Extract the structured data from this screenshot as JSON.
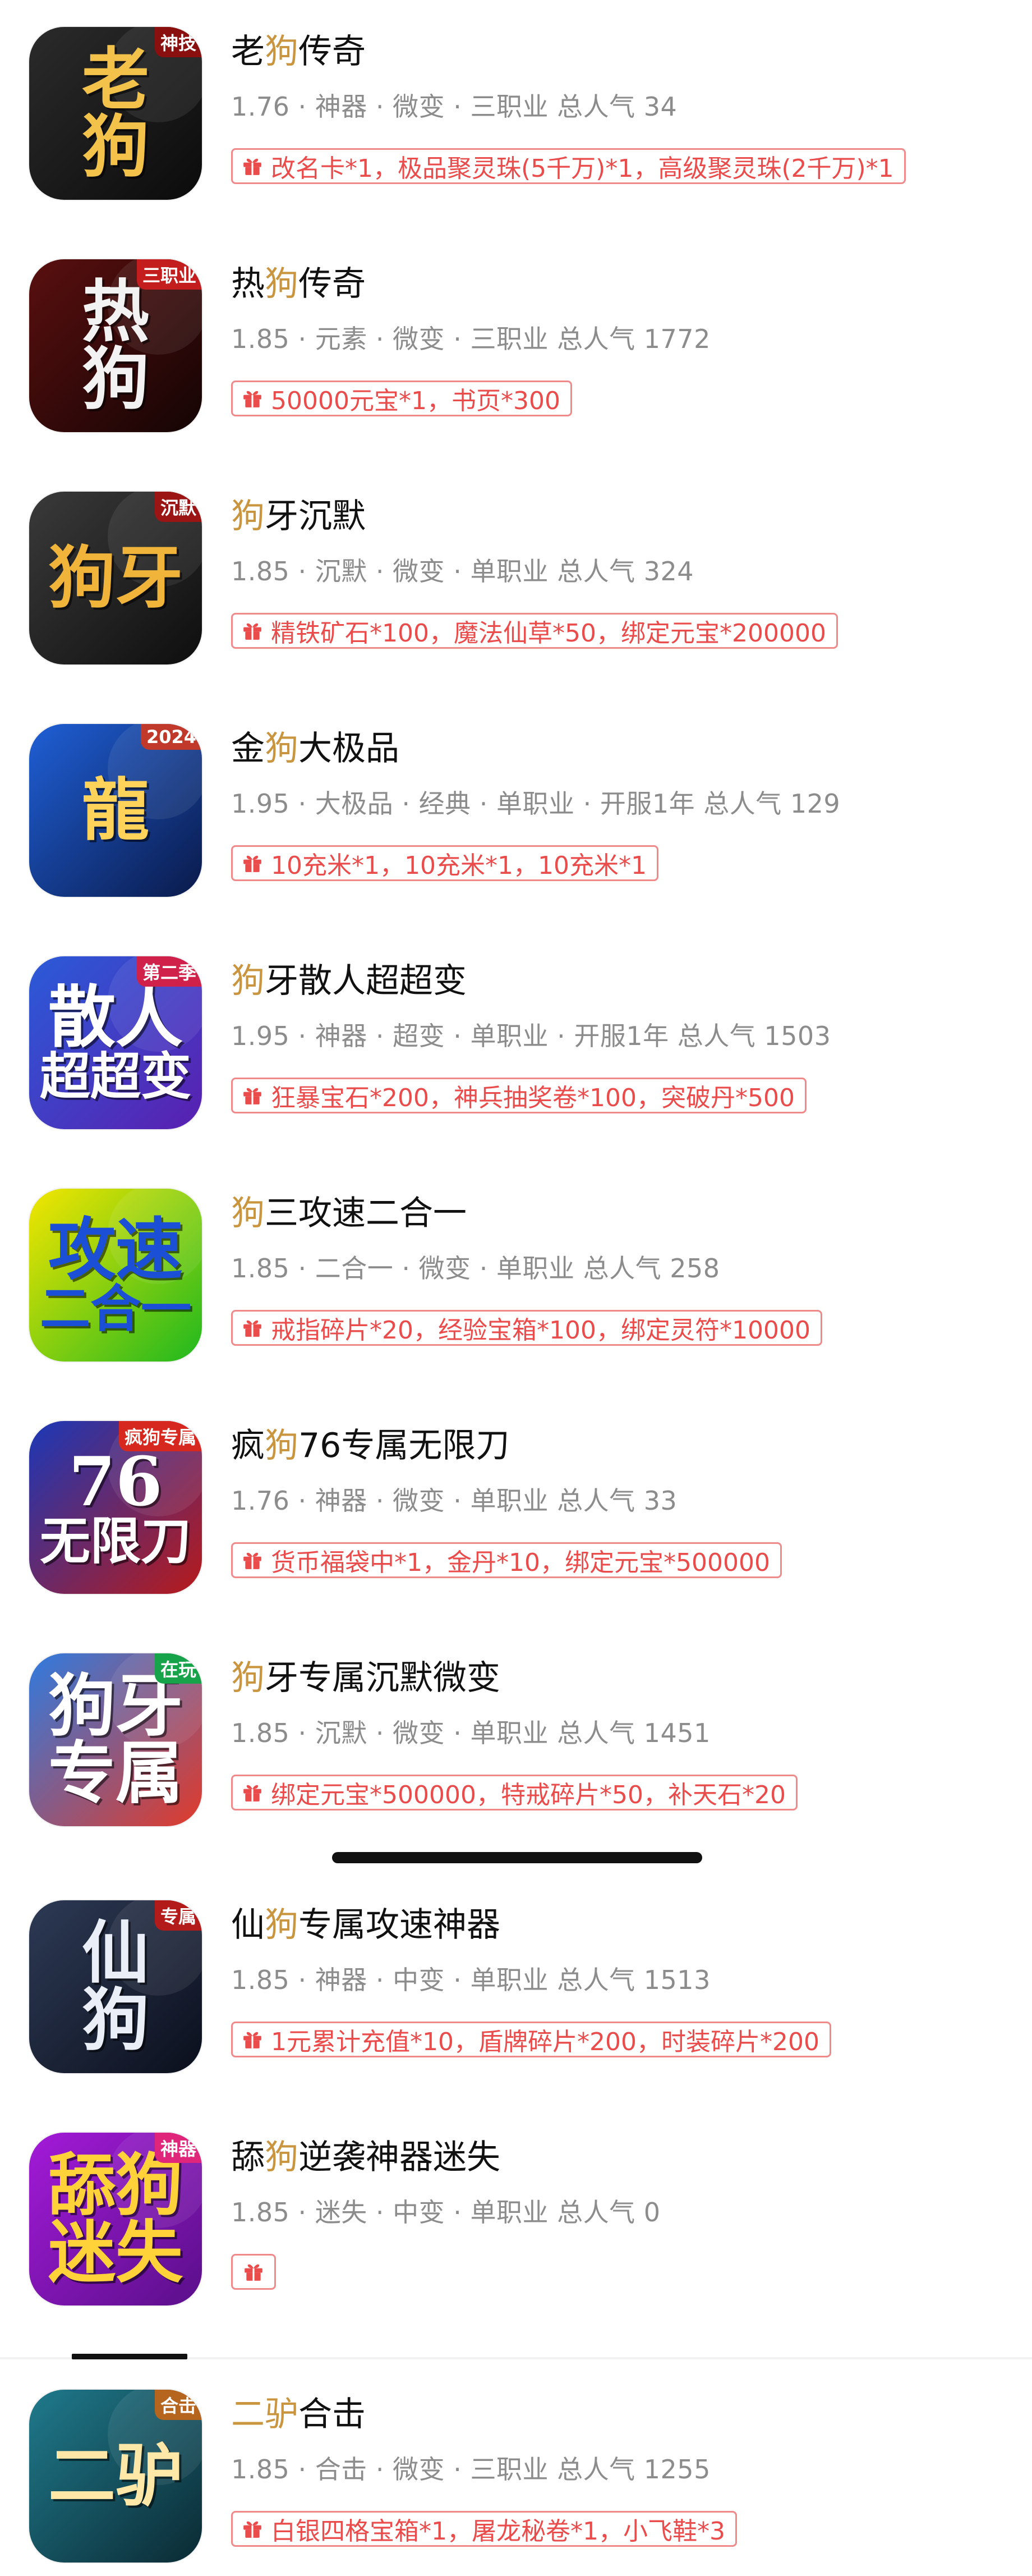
{
  "games": [
    {
      "pre": "老",
      "hl": "狗",
      "post": "传奇",
      "meta": "1.76 · 神器 · 微变 · 三职业  总人气 34",
      "gift": "改名卡*1，极品聚灵珠(5千万)*1，高级聚灵珠(2千万)*1",
      "icon": {
        "lines": [
          "老",
          "狗"
        ],
        "corner": "神技",
        "bg1": "#2b2b2b",
        "bg2": "#0b0b0b",
        "color": "#f3c24a",
        "corner_bg": "#8a1010"
      }
    },
    {
      "pre": "热",
      "hl": "狗",
      "post": "传奇",
      "meta": "1.85 · 元素 · 微变 · 三职业  总人气 1772",
      "gift": "50000元宝*1，书页*300",
      "icon": {
        "lines": [
          "热",
          "狗"
        ],
        "corner": "三职业",
        "bg1": "#5a0f0f",
        "bg2": "#140404",
        "color": "#f2f2f2",
        "corner_bg": "#c41d1d"
      }
    },
    {
      "pre": "",
      "hl": "狗",
      "post": "牙沉默",
      "meta": "1.85 · 沉默 · 微变 · 单职业  总人气 324",
      "gift": "精铁矿石*100，魔法仙草*50，绑定元宝*200000",
      "icon": {
        "lines": [
          "狗牙"
        ],
        "corner": "沉默",
        "bg1": "#3a3a3a",
        "bg2": "#0e0e0e",
        "color": "#f0b43a",
        "corner_bg": "#9b1515"
      }
    },
    {
      "pre": "金",
      "hl": "狗",
      "post": "大极品",
      "meta": "1.95 · 大极品 · 经典 · 单职业 · 开服1年  总人气 129",
      "gift": "10充米*1，10充米*1，10充米*1",
      "icon": {
        "lines": [
          "龍"
        ],
        "corner": "2024",
        "bg1": "#1f5fd6",
        "bg2": "#0a1a4a",
        "color": "#ffd35a",
        "corner_bg": "#c0392b"
      }
    },
    {
      "pre": "",
      "hl": "狗",
      "post": "牙散人超超变",
      "meta": "1.95 · 神器 · 超变 · 单职业 · 开服1年  总人气 1503",
      "gift": "狂暴宝石*200，神兵抽奖卷*100，突破丹*500",
      "icon": {
        "lines": [
          "散人",
          "超超变"
        ],
        "corner": "第二季",
        "bg1": "#2a5bd8",
        "bg2": "#5a1fb0",
        "color": "#ffffff",
        "corner_bg": "#d0214a"
      }
    },
    {
      "pre": "",
      "hl": "狗",
      "post": "三攻速二合一",
      "meta": "1.85 · 二合一 · 微变 · 单职业  总人气 258",
      "gift": "戒指碎片*20，经验宝箱*100，绑定灵符*10000",
      "icon": {
        "lines": [
          "攻速",
          "二合一"
        ],
        "corner": "",
        "bg1": "#f4e600",
        "bg2": "#1fb81f",
        "color": "#1b4fd6",
        "corner_bg": "#e01bd3"
      }
    },
    {
      "pre": "疯",
      "hl": "狗",
      "post": "76专属无限刀",
      "meta": "1.76 · 神器 · 微变 · 单职业  总人气 33",
      "gift": "货币福袋中*1，金丹*10，绑定元宝*500000",
      "icon": {
        "lines": [
          "76",
          "无限刀"
        ],
        "corner": "疯狗专属",
        "bg1": "#1a38b8",
        "bg2": "#b81a1a",
        "color": "#ffffff",
        "corner_bg": "#d7281f"
      }
    },
    {
      "pre": "",
      "hl": "狗",
      "post": "牙专属沉默微变",
      "meta": "1.85 · 沉默 · 微变 · 单职业  总人气 1451",
      "gift": "绑定元宝*500000，特戒碎片*50，补天石*20",
      "icon": {
        "lines": [
          "狗牙",
          "专属"
        ],
        "corner": "在玩",
        "bg1": "#2f7be0",
        "bg2": "#e23a2a",
        "color": "#ffffff",
        "corner_bg": "#16a34a"
      }
    },
    {
      "pre": "仙",
      "hl": "狗",
      "post": "专属攻速神器",
      "meta": "1.85 · 神器 · 中变 · 单职业  总人气 1513",
      "gift": "1元累计充值*10，盾牌碎片*200，时装碎片*200",
      "icon": {
        "lines": [
          "仙",
          "狗"
        ],
        "corner": "专属",
        "bg1": "#2d3a55",
        "bg2": "#0b0f1c",
        "color": "#e9eef7",
        "corner_bg": "#b31b1b"
      }
    },
    {
      "pre": "舔",
      "hl": "狗",
      "post": "逆袭神器迷失",
      "meta": "1.85 · 迷失 · 中变 · 单职业  总人气 0",
      "gift": "",
      "icon": {
        "lines": [
          "舔狗",
          "迷失"
        ],
        "corner": "神器",
        "bg1": "#a31ad8",
        "bg2": "#5a0f8a",
        "color": "#ffd23a",
        "corner_bg": "#e0267a"
      }
    },
    {
      "pre": "",
      "hl": "二驴",
      "post": "合击",
      "meta": "1.85 · 合击 · 微变 · 三职业  总人气 1255",
      "gift": "白银四格宝箱*1，屠龙秘卷*1，小飞鞋*3",
      "icon": {
        "lines": [
          "二驴"
        ],
        "corner": "合击",
        "bg1": "#1f7a8c",
        "bg2": "#0b2a33",
        "color": "#ffe7a8",
        "corner_bg": "#b5651d"
      }
    }
  ],
  "colors": {
    "highlight": "#c9953f",
    "gift": "#ea4b4b",
    "meta": "#8c8c8c"
  }
}
